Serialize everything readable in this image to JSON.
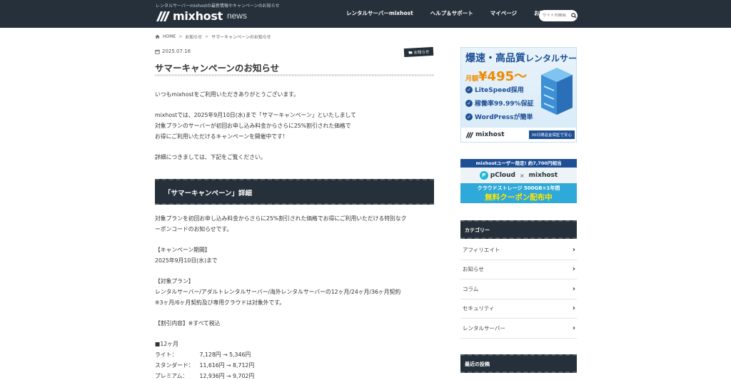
{
  "header": {
    "tagline": "レンタルサーバーmixhostの最新情報やキャンペーンのお知らせ",
    "logo_text": "mixhost",
    "logo_sub": "news",
    "nav": [
      "レンタルサーバーmixhost",
      "ヘルプ＆サポート",
      "マイページ",
      "お問い合わせ"
    ],
    "search_placeholder": "サイト内検索"
  },
  "breadcrumb": {
    "home": "HOME",
    "sep": ">",
    "category": "お知らせ",
    "current": "サマーキャンペーンのお知らせ"
  },
  "article": {
    "date": "2025.07.16",
    "category_tag": "お知らせ",
    "title": "サマーキャンペーンのお知らせ",
    "intro": [
      "いつもmixhostをご利用いただきありがとうございます。",
      "mixhostでは、2025年9月10日(水)まで「サマーキャンペーン」といたしまして",
      "対象プランのサーバーが初回お申し込み料金からさらに25%割引された価格で",
      "お得にご利用いただけるキャンペーンを開催中です！",
      "詳細につきましては、下記をご覧ください。"
    ],
    "section_heading": "「サマーキャンペーン」詳細",
    "detail": [
      "対象プランを初回お申し込み料金からさらに25%割引された価格でお得にご利用いただける特別なク",
      "ーポンコードのお知らせです。",
      "【キャンペーン期間】",
      "2025年9月10日(水)まで",
      "【対象プラン】",
      "レンタルサーバー/アダルトレンタルサーバー/海外レンタルサーバーの12ヶ月/24ヶ月/36ヶ月契約",
      "※3ヶ月/6ヶ月契約及び専用クラウドは対象外です。",
      "【割引内容】※すべて税込",
      "■12ヶ月"
    ],
    "prices": [
      {
        "label": "ライト：",
        "value": "7,128円 → 5,346円"
      },
      {
        "label": "スタンダード：",
        "value": "11,616円 → 8,712円"
      },
      {
        "label": "プレミアム：",
        "value": "12,936円 → 9,702円"
      }
    ]
  },
  "sidebar": {
    "ad1": {
      "headline_a": "爆速・高品質",
      "headline_b": "レンタルサーバー",
      "price_prefix": "月額",
      "price": "¥495〜",
      "features": [
        "LiteSpeed採用",
        "稼働率99.99%保証",
        "WordPressが簡単"
      ],
      "logo": "mixhost",
      "guarantee": "30日間返金保証で安心"
    },
    "ad2": {
      "top": "mixhostユーザー限定! 約7,700円相当",
      "brand_a": "pCloud",
      "x": "×",
      "brand_b": "mixhost",
      "line1": "クラウドストレージ 500GB×1年間",
      "line2": "無料クーポン配布中"
    },
    "category_title": "カテゴリー",
    "categories": [
      "アフィリエイト",
      "お知らせ",
      "コラム",
      "セキュリティ",
      "レンタルサーバー"
    ],
    "recent_title": "最近の投稿"
  },
  "colors": {
    "header_bg": "#25303a",
    "accent_blue": "#1e4f96",
    "price_orange": "#f08a00"
  }
}
